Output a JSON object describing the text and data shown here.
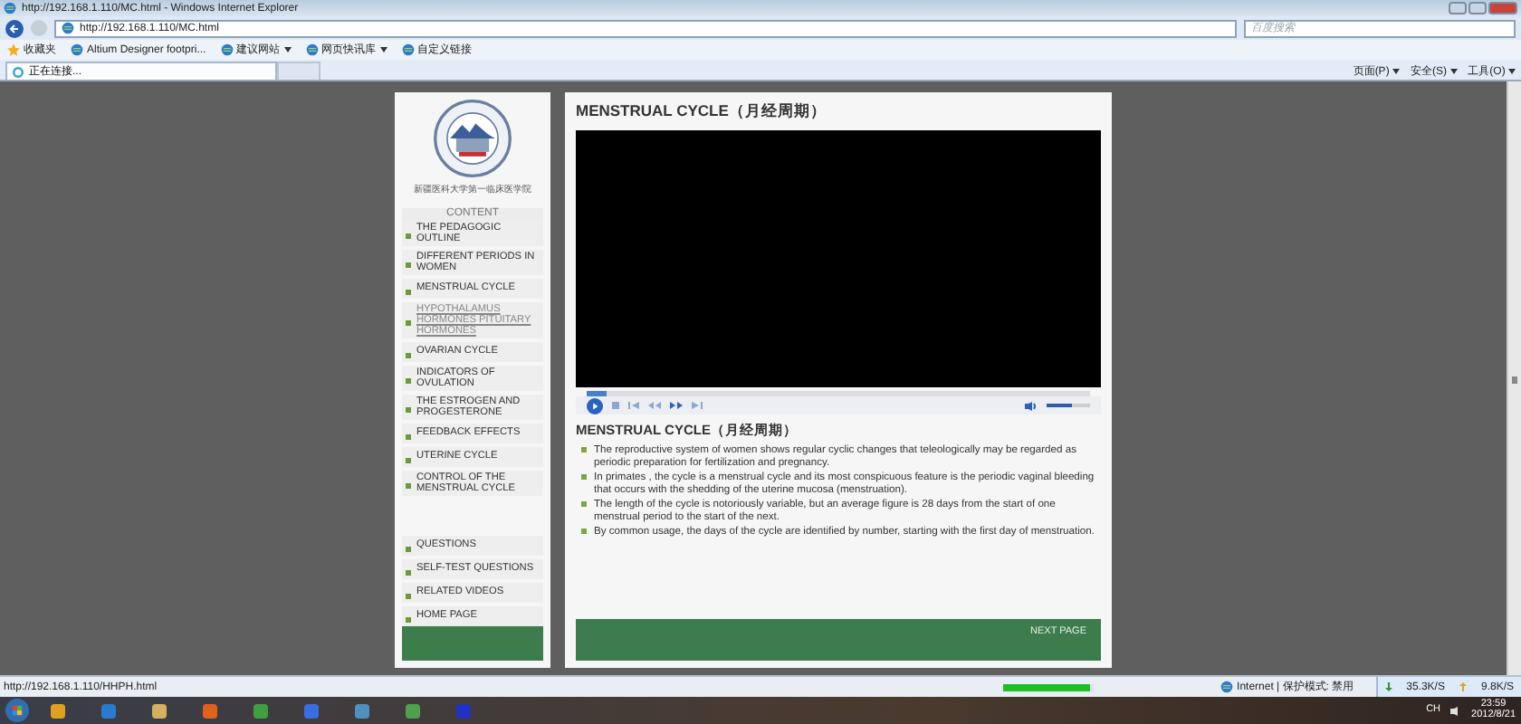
{
  "window": {
    "title": "http://192.168.1.110/MC.html - Windows Internet Explorer"
  },
  "address_bar": {
    "url": "http://192.168.1.110/MC.html"
  },
  "search": {
    "placeholder": "百度搜索"
  },
  "favorites_bar": {
    "label": "收藏夹",
    "items": [
      {
        "label": "Altium Designer footpri...",
        "dropdown": false
      },
      {
        "label": "建议网站",
        "dropdown": true
      },
      {
        "label": "网页快讯库",
        "dropdown": true
      },
      {
        "label": "自定义链接",
        "dropdown": false
      }
    ]
  },
  "tabs": [
    {
      "label": "正在连接...",
      "selected": true
    }
  ],
  "command_bar": [
    "页面(P)",
    "安全(S)",
    "工具(O)"
  ],
  "sidebar": {
    "caption": "新疆医科大学第一临床医学院",
    "heading": "CONTENT",
    "items": [
      {
        "label": "THE PEDAGOGIC OUTLINE",
        "selected": false
      },
      {
        "label": "DIFFERENT PERIODS IN WOMEN",
        "selected": false
      },
      {
        "label": "MENSTRUAL CYCLE",
        "selected": false
      },
      {
        "label": "HYPOTHALAMUS HORMONES PITUITARY HORMONES",
        "selected": true
      },
      {
        "label": "OVARIAN CYCLE",
        "selected": false
      },
      {
        "label": "INDICATORS OF OVULATION",
        "selected": false
      },
      {
        "label": "THE ESTROGEN AND PROGESTERONE",
        "selected": false
      },
      {
        "label": "FEEDBACK EFFECTS",
        "selected": false
      },
      {
        "label": "UTERINE CYCLE",
        "selected": false
      },
      {
        "label": "CONTROL OF THE MENSTRUAL CYCLE",
        "selected": false
      }
    ],
    "links": [
      "QUESTIONS",
      "SELF-TEST QUESTIONS",
      "RELATED VIDEOS",
      "HOME PAGE"
    ]
  },
  "main": {
    "title": "MENSTRUAL CYCLE（月经周期）",
    "player": {
      "position": {
        "level": 0.04
      },
      "volume": {
        "level": 0.6
      }
    },
    "heading": "MENSTRUAL CYCLE（月经周期）",
    "paragraphs": [
      "The reproductive system of women shows regular cyclic changes that teleologically may be regarded as periodic preparation for fertilization and pregnancy.",
      "In primates , the cycle is a menstrual cycle and its most conspicuous feature is the periodic vaginal bleeding that occurs with the shedding of the uterine mucosa (menstruation).",
      "The length of the cycle is notoriously variable, but an average figure is 28 days from the start of one menstrual period to the start of the next.",
      "By common usage, the days of the cycle are identified by number, starting with the first day of menstruation."
    ],
    "next_button": "NEXT PAGE"
  },
  "status_bar": {
    "url": "http://192.168.1.110/HHPH.html",
    "progress": {
      "level": 0.95
    },
    "zone": "Internet | 保护模式: 禁用",
    "download": "35.3K/S",
    "upload": "9.8K/S"
  },
  "taskbar": {
    "language": "CH",
    "time": "23:59",
    "date": "2012/8/21"
  }
}
